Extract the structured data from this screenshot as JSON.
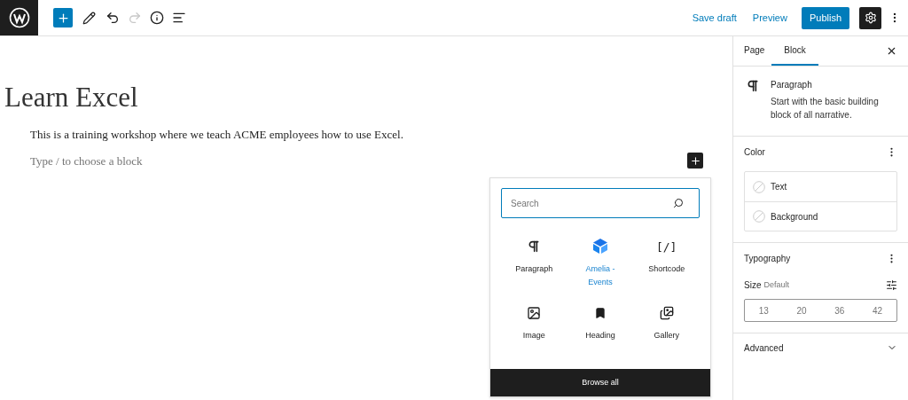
{
  "toolbar": {
    "actions": [
      "Save draft",
      "Preview"
    ],
    "publish": "Publish",
    "settings_active": true,
    "redo_disabled": true
  },
  "editor": {
    "title": "Learn Excel",
    "paragraph": "This is a training workshop where we teach ACME employees how to use Excel.",
    "placeholder": "Type / to choose a block"
  },
  "inserter": {
    "search": {
      "placeholder": "Search"
    },
    "blocks": [
      {
        "label": "Paragraph",
        "selected": false
      },
      {
        "label": "Amelia - Events",
        "selected": true
      },
      {
        "label": "Shortcode",
        "selected": false,
        "glyph": "[/]"
      },
      {
        "label": "Image",
        "selected": false
      },
      {
        "label": "Heading",
        "selected": false
      },
      {
        "label": "Gallery",
        "selected": false
      }
    ],
    "browse_all": "Browse all"
  },
  "sidebar": {
    "tabs": [
      {
        "label": "Page",
        "selected": false
      },
      {
        "label": "Block",
        "selected": true
      }
    ],
    "block_card": {
      "title": "Paragraph",
      "description": "Start with the basic building block of all narrative."
    },
    "color": {
      "title": "Color",
      "items": [
        "Text",
        "Background"
      ]
    },
    "typography": {
      "title": "Typography",
      "size_label": "Size",
      "size_value": "Default",
      "sizes": [
        "13",
        "20",
        "36",
        "42"
      ]
    },
    "advanced": {
      "title": "Advanced",
      "expanded": false
    }
  }
}
